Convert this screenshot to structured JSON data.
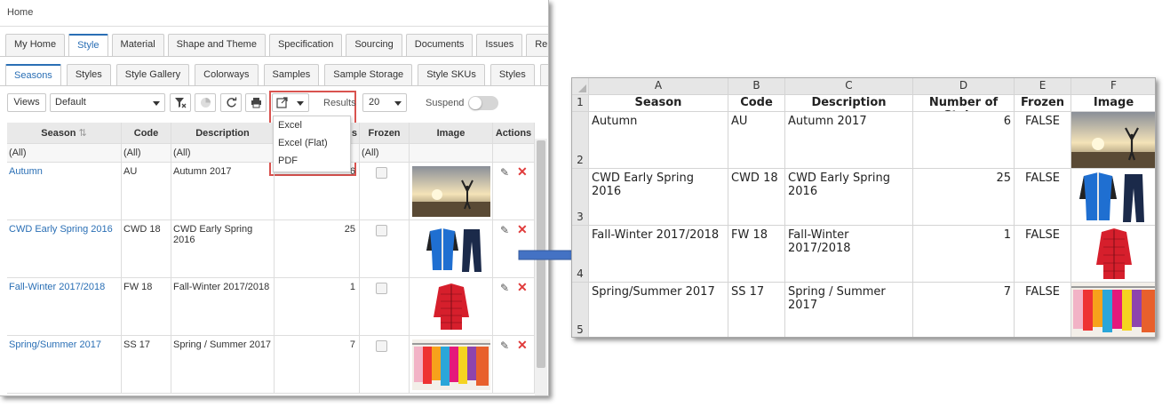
{
  "app": {
    "breadcrumb": "Home",
    "main_tabs": [
      "My Home",
      "Style",
      "Material",
      "Shape and Theme",
      "Specification",
      "Sourcing",
      "Documents",
      "Issues",
      "Repo"
    ],
    "active_main_tab": "Style",
    "sub_tabs": [
      "Seasons",
      "Styles",
      "Style Gallery",
      "Colorways",
      "Samples",
      "Sample Storage",
      "Style SKUs",
      "Styles",
      "Supplie"
    ],
    "active_sub_tab": "Seasons",
    "toolbar": {
      "views_label": "Views",
      "view_select_value": "Default",
      "results_label": "Results",
      "results_value": "20",
      "suspend_label": "Suspend"
    },
    "export_menu": [
      "Excel",
      "Excel (Flat)",
      "PDF"
    ],
    "grid": {
      "headers": [
        "Season",
        "Code",
        "Description",
        "s",
        "Frozen",
        "Image",
        "Actions"
      ],
      "filters": [
        "(All)",
        "(All)",
        "(All)",
        "",
        "(All)",
        "",
        ""
      ],
      "rows": [
        {
          "season": "Autumn",
          "code": "AU",
          "description": "Autumn 2017",
          "count": "6"
        },
        {
          "season": "CWD Early Spring 2016",
          "code": "CWD 18",
          "description": "CWD Early Spring 2016",
          "count": "25"
        },
        {
          "season": "Fall-Winter 2017/2018",
          "code": "FW 18",
          "description": "Fall-Winter 2017/2018",
          "count": "1"
        },
        {
          "season": "Spring/Summer 2017",
          "code": "SS 17",
          "description": "Spring / Summer 2017",
          "count": "7"
        }
      ]
    }
  },
  "sheet": {
    "columns": [
      "A",
      "B",
      "C",
      "D",
      "E",
      "F"
    ],
    "row_numbers": [
      "1",
      "2",
      "3",
      "4",
      "5"
    ],
    "headers": [
      "Season",
      "Code",
      "Description",
      "Number of Styles",
      "Frozen",
      "Image"
    ],
    "rows": [
      {
        "season": "Autumn",
        "code": "AU",
        "description": "Autumn 2017",
        "styles": "6",
        "frozen": "FALSE"
      },
      {
        "season": "CWD Early Spring 2016",
        "code": "CWD 18",
        "description": "CWD Early Spring 2016",
        "styles": "25",
        "frozen": "FALSE"
      },
      {
        "season": "Fall-Winter 2017/2018",
        "code": "FW 18",
        "description": "Fall-Winter 2017/2018",
        "styles": "1",
        "frozen": "FALSE"
      },
      {
        "season": "Spring/Summer 2017",
        "code": "SS 17",
        "description": "Spring / Summer 2017",
        "styles": "7",
        "frozen": "FALSE"
      }
    ]
  },
  "colors": {
    "link": "#2a6fb5",
    "highlight": "#d9534f",
    "arrow": "#4472c4",
    "delete": "#e03b3b"
  }
}
